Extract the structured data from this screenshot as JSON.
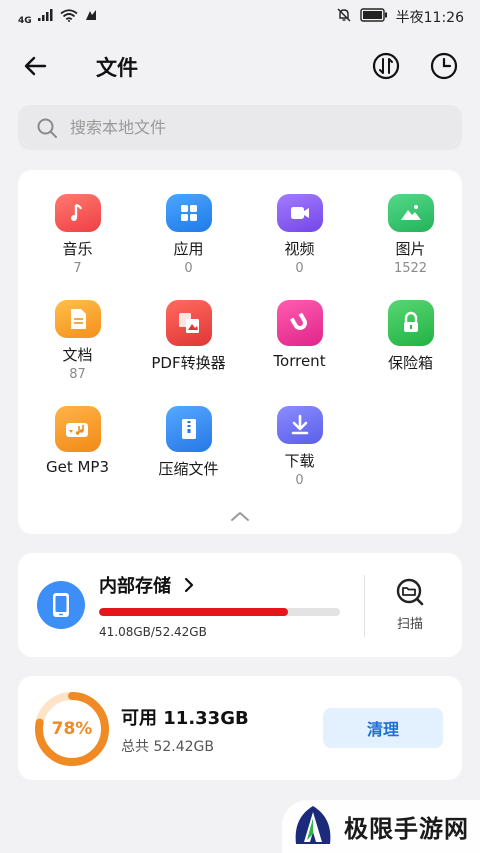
{
  "status": {
    "network": "4G",
    "time": "半夜11:26"
  },
  "header": {
    "title": "文件"
  },
  "search": {
    "placeholder": "搜索本地文件"
  },
  "categories": [
    {
      "label": "音乐",
      "count": "7",
      "icon": "music-icon",
      "color": "#f2524f"
    },
    {
      "label": "应用",
      "count": "0",
      "icon": "apps-icon",
      "color": "#2f8cf0"
    },
    {
      "label": "视频",
      "count": "0",
      "icon": "video-icon",
      "color": "#8a5cf0"
    },
    {
      "label": "图片",
      "count": "1522",
      "icon": "image-icon",
      "color": "#33c46d"
    },
    {
      "label": "文档",
      "count": "87",
      "icon": "document-icon",
      "color": "#f8a12b"
    },
    {
      "label": "PDF转换器",
      "count": "",
      "icon": "pdf-converter-icon",
      "color": "#ef4b4b"
    },
    {
      "label": "Torrent",
      "count": "",
      "icon": "torrent-magnet-icon",
      "color": "#ec3f9a"
    },
    {
      "label": "保险箱",
      "count": "",
      "icon": "safe-lock-icon",
      "color": "#39c05a"
    },
    {
      "label": "Get MP3",
      "count": "",
      "icon": "get-mp3-icon",
      "color": "#f59a26"
    },
    {
      "label": "压缩文件",
      "count": "",
      "icon": "archive-icon",
      "color": "#3a8ff2"
    },
    {
      "label": "下载",
      "count": "0",
      "icon": "download-icon",
      "color": "#6b6ff0"
    }
  ],
  "storage": {
    "title": "内部存储",
    "size_text": "41.08GB/52.42GB",
    "used_fraction": 0.784,
    "bar_color": "#e5161b",
    "scan_label": "扫描"
  },
  "cleanup": {
    "percent_text": "78%",
    "percent": 78,
    "available": "可用 11.33GB",
    "total": "总共 52.42GB",
    "clean_label": "清理",
    "ring_color": "#f08a24"
  },
  "watermark": {
    "text": "极限手游网"
  }
}
